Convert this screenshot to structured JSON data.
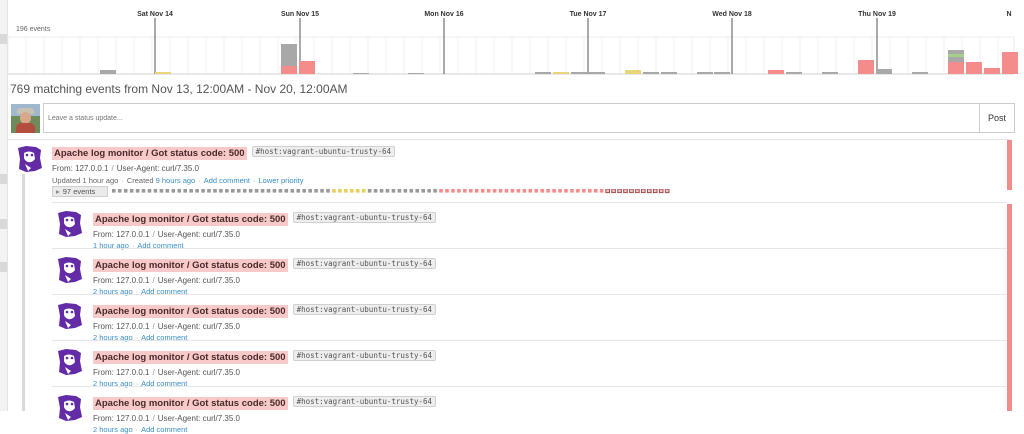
{
  "timeline": {
    "count_label": "196 events",
    "days": [
      {
        "label": "Sat Nov 14",
        "color": "#333333"
      },
      {
        "label": "Sun Nov 15",
        "color": "#333333"
      },
      {
        "label": "Mon Nov 16",
        "color": "#333333"
      },
      {
        "label": "Tue Nov 17",
        "color": "#333333"
      },
      {
        "label": "Wed Nov 18",
        "color": "#333333"
      },
      {
        "label": "Thu Nov 19",
        "color": "#333333"
      },
      {
        "label": "N",
        "color": "#e0483e"
      }
    ],
    "colors": {
      "error": "#f58c8c",
      "neutral": "#a8a8a8",
      "warning": "#e8d67a",
      "success": "#a6cf87"
    }
  },
  "summary": "769 matching events from Nov 13, 12:00AM - Nov 20, 12:00AM",
  "status": {
    "placeholder": "Leave a status update...",
    "post_label": "Post"
  },
  "stream": {
    "main": {
      "title": "Apache log monitor / Got status code: 500",
      "tag": "#host:vagrant-ubuntu-trusty-64",
      "from": "From: 127.0.0.1",
      "user_agent": "User-Agent: curl/7.35.0",
      "updated": "Updated 1 hour ago",
      "created_prefix": "Created",
      "created_link": "9 hours ago",
      "add_comment": "Add comment",
      "lower_priority": "Lower priority"
    },
    "rollup": {
      "label": "97 events",
      "toggle_glyph": "▸"
    },
    "children": [
      {
        "title": "Apache log monitor / Got status code: 500",
        "tag": "#host:vagrant-ubuntu-trusty-64",
        "from": "From: 127.0.0.1",
        "user_agent": "User-Agent: curl/7.35.0",
        "time": "1 hour ago",
        "add_comment": "Add comment"
      },
      {
        "title": "Apache log monitor / Got status code: 500",
        "tag": "#host:vagrant-ubuntu-trusty-64",
        "from": "From: 127.0.0.1",
        "user_agent": "User-Agent: curl/7.35.0",
        "time": "2 hours ago",
        "add_comment": "Add comment"
      },
      {
        "title": "Apache log monitor / Got status code: 500",
        "tag": "#host:vagrant-ubuntu-trusty-64",
        "from": "From: 127.0.0.1",
        "user_agent": "User-Agent: curl/7.35.0",
        "time": "2 hours ago",
        "add_comment": "Add comment"
      },
      {
        "title": "Apache log monitor / Got status code: 500",
        "tag": "#host:vagrant-ubuntu-trusty-64",
        "from": "From: 127.0.0.1",
        "user_agent": "User-Agent: curl/7.35.0",
        "time": "2 hours ago",
        "add_comment": "Add comment"
      },
      {
        "title": "Apache log monitor / Got status code: 500",
        "tag": "#host:vagrant-ubuntu-trusty-64",
        "from": "From: 127.0.0.1",
        "user_agent": "User-Agent: curl/7.35.0",
        "time": "2 hours ago",
        "add_comment": "Add comment"
      }
    ],
    "status_color": "#f08c8c",
    "logo_color": "#632ca6"
  },
  "icons": {
    "event_logo": "datadog-dog-icon",
    "rollup_toggle": "triangle-right-icon",
    "user_avatar": "user-avatar"
  }
}
